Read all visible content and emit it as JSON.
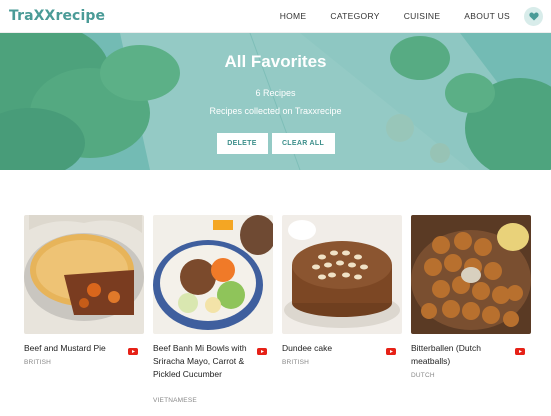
{
  "header": {
    "logo": "TraXXrecipe",
    "nav": [
      "HOME",
      "CATEGORY",
      "CUISINE",
      "ABOUT US"
    ]
  },
  "hero": {
    "title": "All Favorites",
    "count": "6 Recipes",
    "subtitle": "Recipes collected on Traxxrecipe",
    "delete_label": "DELETE",
    "clear_label": "CLEAR ALL"
  },
  "recipes": [
    {
      "title": "Beef and Mustard Pie",
      "cuisine": "BRITISH"
    },
    {
      "title": "Beef Banh Mi Bowls with Sriracha Mayo, Carrot & Pickled Cucumber",
      "cuisine": "VIETNAMESE"
    },
    {
      "title": "Dundee cake",
      "cuisine": "BRITISH"
    },
    {
      "title": "Bitterballen (Dutch meatballs)",
      "cuisine": "DUTCH"
    }
  ],
  "colors": {
    "brand": "#4a9b97",
    "hero_overlay": "#50aaa2",
    "youtube": "#e62117"
  }
}
